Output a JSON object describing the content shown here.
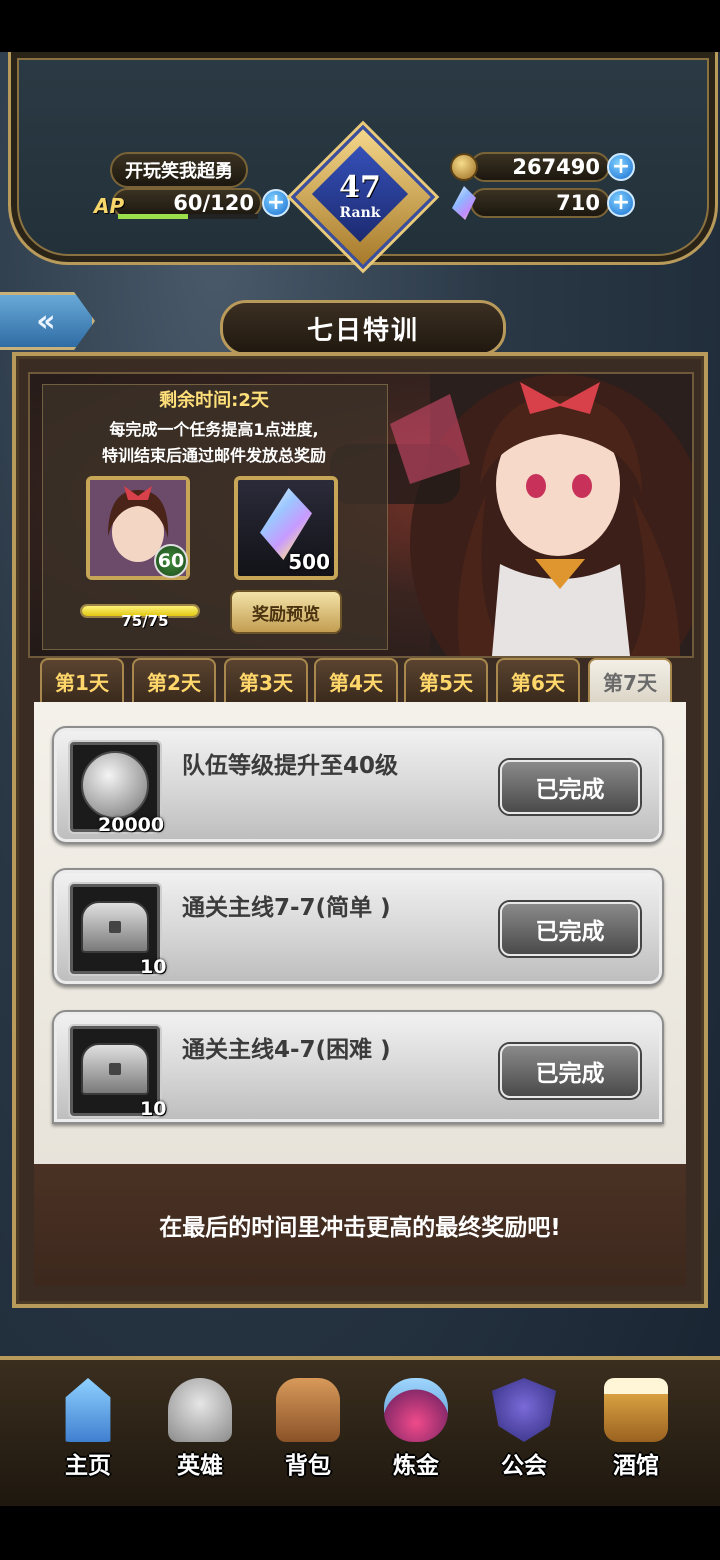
{
  "player": {
    "name": "开玩笑我超勇",
    "ap_label": "AP",
    "ap_value": "60/120",
    "ap_fraction": 0.5,
    "rank_number": "47",
    "rank_label": "Rank",
    "gold": "267490",
    "crystals": "710"
  },
  "page": {
    "title": "七日特训"
  },
  "event": {
    "time_left": "剩余时间:2天",
    "description_line1": "每完成一个任务提高1点进度,",
    "description_line2": "特训结束后通过邮件发放总奖励",
    "hero_reward_level": "60",
    "crystal_reward_qty": "500",
    "progress_text": "75/75",
    "progress_fraction": 1.0,
    "preview_button": "奖励预览"
  },
  "tabs": [
    {
      "label": "第1天"
    },
    {
      "label": "第2天"
    },
    {
      "label": "第3天"
    },
    {
      "label": "第4天"
    },
    {
      "label": "第5天"
    },
    {
      "label": "第6天"
    },
    {
      "label": "第7天",
      "active": true
    }
  ],
  "tasks": [
    {
      "title": "队伍等级提升至40级",
      "reward_icon": "silver-coin-icon",
      "qty": "20000",
      "button": "已完成"
    },
    {
      "title": "通关主线7-7(简单 )",
      "reward_icon": "iron-chest-icon",
      "qty": "10",
      "button": "已完成"
    },
    {
      "title": "通关主线4-7(困难 )",
      "reward_icon": "iron-chest-icon",
      "qty": "10",
      "button": "已完成"
    }
  ],
  "footer_message": "在最后的时间里冲击更高的最终奖励吧!",
  "nav": [
    {
      "label": "主页",
      "icon": "castle-icon"
    },
    {
      "label": "英雄",
      "icon": "helmet-icon"
    },
    {
      "label": "背包",
      "icon": "backpack-icon"
    },
    {
      "label": "炼金",
      "icon": "potion-icon"
    },
    {
      "label": "公会",
      "icon": "guild-shield-icon"
    },
    {
      "label": "酒馆",
      "icon": "tavern-mug-icon"
    }
  ],
  "colors": {
    "accent_gold": "#b89a5a",
    "tab_text": "#ffd76a",
    "plus_button": "#1a6fd0",
    "ap_bar": "#9be04a",
    "progress_bar": "#f2e020"
  }
}
